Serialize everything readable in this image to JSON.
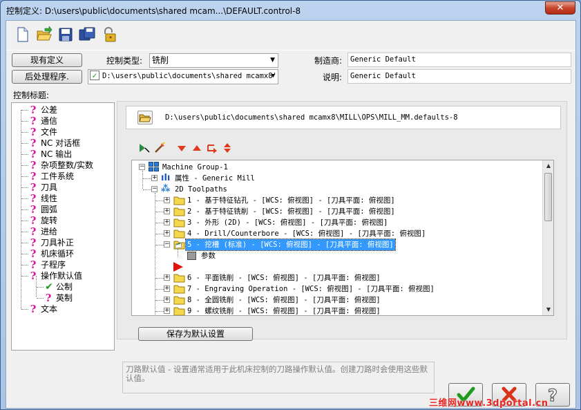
{
  "window": {
    "title": "控制定义: D:\\users\\public\\documents\\shared mcam...\\DEFAULT.control-8",
    "close_label": "✕"
  },
  "toolbar": {
    "icons": [
      "new-file-icon",
      "open-folder-icon",
      "save-icon",
      "save-as-icon",
      "lock-icon"
    ]
  },
  "header": {
    "existing_def_button": "现有定义",
    "post_button": "后处理程序.",
    "control_type_label": "控制类型:",
    "control_type_value": "铣削",
    "post_path": "D:\\users\\public\\documents\\shared mcamx8'",
    "maker_label": "制造商:",
    "maker_value": "Generic Default",
    "desc_label": "说明:",
    "desc_value": "Generic Default"
  },
  "control_topics": {
    "label": "控制标题:",
    "items": [
      {
        "label": "公差",
        "icon": "question-icon",
        "indent": 0
      },
      {
        "label": "通信",
        "icon": "question-icon",
        "indent": 0
      },
      {
        "label": "文件",
        "icon": "question-icon",
        "indent": 0
      },
      {
        "label": "NC 对话框",
        "icon": "question-icon",
        "indent": 0
      },
      {
        "label": "NC 输出",
        "icon": "question-icon",
        "indent": 0
      },
      {
        "label": "杂项整数/实数",
        "icon": "question-icon",
        "indent": 0
      },
      {
        "label": "工件系统",
        "icon": "question-icon",
        "indent": 0
      },
      {
        "label": "刀具",
        "icon": "question-icon",
        "indent": 0
      },
      {
        "label": "线性",
        "icon": "question-icon",
        "indent": 0
      },
      {
        "label": "圆弧",
        "icon": "question-icon",
        "indent": 0
      },
      {
        "label": "旋转",
        "icon": "question-icon",
        "indent": 0
      },
      {
        "label": "进给",
        "icon": "question-icon",
        "indent": 0
      },
      {
        "label": "刀具补正",
        "icon": "question-icon",
        "indent": 0
      },
      {
        "label": "机床循环",
        "icon": "question-icon",
        "indent": 0
      },
      {
        "label": "子程序",
        "icon": "question-icon",
        "indent": 0
      },
      {
        "label": "操作默认值",
        "icon": "question-icon",
        "indent": 0
      },
      {
        "label": "公制",
        "icon": "check-icon",
        "indent": 1
      },
      {
        "label": "英制",
        "icon": "question-icon",
        "indent": 1
      },
      {
        "label": "文本",
        "icon": "question-icon",
        "indent": 0
      }
    ]
  },
  "defaults_file": {
    "path": "D:\\users\\public\\documents\\shared mcamx8\\MILL\\OPS\\MILL_MM.defaults-8"
  },
  "ops_toolbar": {
    "icons": [
      "select-arrow-icon",
      "edit-wand-icon",
      "move-down-icon",
      "move-up-icon",
      "insert-arrow-icon",
      "sort-icon"
    ]
  },
  "ops_tree": {
    "root": "Machine Group-1",
    "properties": "属性 - Generic Mill",
    "toolpaths_group": "2D Toolpaths",
    "operations": [
      "1 - 基于特征钻孔 - [WCS: 俯视图] - [刀具平面: 俯视图]",
      "2 - 基于特征铣削 - [WCS: 俯视图] - [刀具平面: 俯视图]",
      "3 - 外形 (2D) - [WCS: 俯视图] - [刀具平面: 俯视图]",
      "4 - Drill/Counterbore - [WCS: 俯视图] - [刀具平面: 俯视图]",
      "5 - 挖槽 (标准) - [WCS: 俯视图] - [刀具平面: 俯视图]",
      "6 - 平面铣削 - [WCS: 俯视图] - [刀具平面: 俯视图]",
      "7 - Engraving Operation - [WCS: 俯视图] - [刀具平面: 俯视图]",
      "8 - 全圆铣削 - [WCS: 俯视图] - [刀具平面: 俯视图]",
      "9 - 螺纹铣削 - [WCS: 俯视图] - [刀具平面: 俯视图]"
    ],
    "selected_index": 4,
    "selected_child": "参数"
  },
  "save_default_button": "保存为默认设置",
  "description_text": "刀路默认值 - 设置通常适用于此机床控制的刀路操作默认值。创建刀路时会使用这些默认值。",
  "watermark": "三维网www.3dportal.cn",
  "colors": {
    "question": "#e0149a",
    "check": "#1a9a1a",
    "folder": "#f5d84a",
    "selection": "#3399ff"
  }
}
